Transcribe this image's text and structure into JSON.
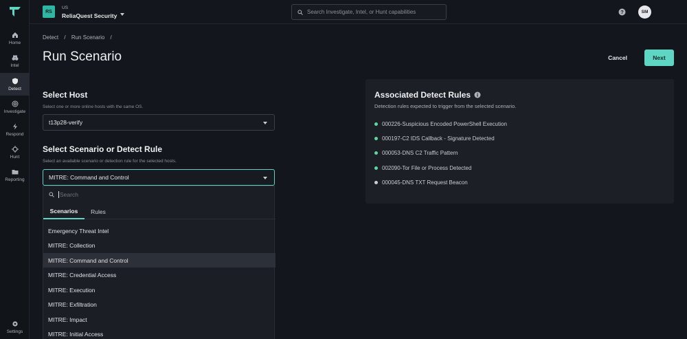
{
  "sidebar": {
    "items": [
      {
        "label": "Home",
        "icon": "home-icon"
      },
      {
        "label": "Intel",
        "icon": "binoculars-icon"
      },
      {
        "label": "Detect",
        "icon": "shield-icon",
        "active": true
      },
      {
        "label": "Investigate",
        "icon": "radar-icon"
      },
      {
        "label": "Respond",
        "icon": "bolt-icon"
      },
      {
        "label": "Hunt",
        "icon": "crosshair-icon"
      },
      {
        "label": "Reporting",
        "icon": "folder-icon"
      }
    ],
    "settings_label": "Settings"
  },
  "topbar": {
    "org_badge": "RS",
    "org_region": "US",
    "org_name": "ReliaQuest Security",
    "search_placeholder": "Search Investigate, Intel, or Hunt capabilities",
    "avatar": "SM"
  },
  "breadcrumb": [
    "Detect",
    "/",
    "Run Scenario",
    "/"
  ],
  "page": {
    "title": "Run Scenario",
    "cancel_label": "Cancel",
    "next_label": "Next"
  },
  "host": {
    "title": "Select Host",
    "subtitle": "Select one or more online hosts with the same OS.",
    "value": "t13p28-verify"
  },
  "scenario": {
    "title": "Select Scenario or Detect Rule",
    "subtitle": "Select an available scenario or detection rule for the selected hosts.",
    "value": "MITRE: Command and Control",
    "search_placeholder": "Search",
    "tabs": [
      "Scenarios",
      "Rules"
    ],
    "options": [
      "Emergency Threat Intel",
      "MITRE: Collection",
      "MITRE: Command and Control",
      "MITRE: Credential Access",
      "MITRE: Execution",
      "MITRE: Exfiltration",
      "MITRE: Impact",
      "MITRE: Initial Access"
    ]
  },
  "rules_panel": {
    "title": "Associated Detect Rules",
    "subtitle": "Detection rules expected to trigger from the selected scenario.",
    "rules": [
      {
        "text": "000226-Suspicious Encoded PowerShell Execution",
        "status_color": "#5fd6a0"
      },
      {
        "text": "000197-C2 IDS Callback - Signature Detected",
        "status_color": "#5fd6a0"
      },
      {
        "text": "000053-DNS C2 Traffic Pattern",
        "status_color": "#5fd6a0"
      },
      {
        "text": "002090-Tor File or Process Detected",
        "status_color": "#5fd6a0"
      },
      {
        "text": "000045-DNS TXT Request Beacon",
        "status_color": "#c9cdd3"
      }
    ]
  },
  "colors": {
    "accent": "#5fd6c3",
    "background": "#13161c",
    "panel": "#1c1f25"
  }
}
